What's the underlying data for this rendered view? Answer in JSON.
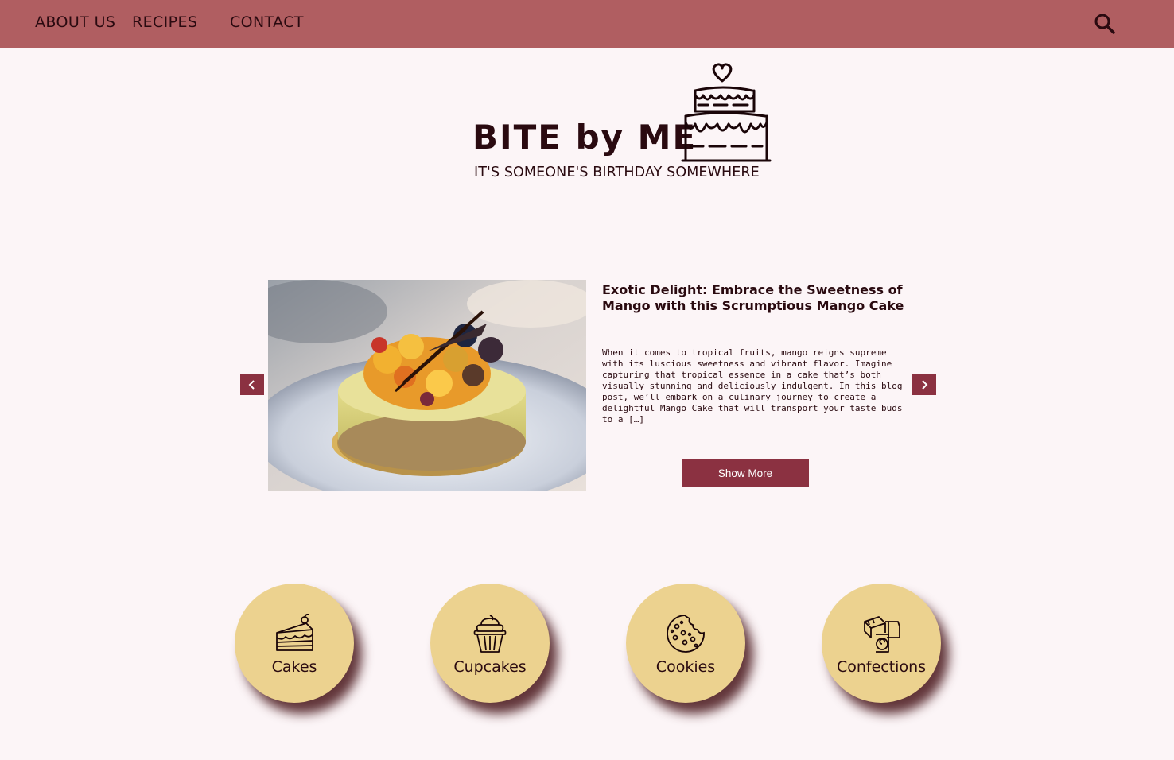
{
  "nav": {
    "items": [
      {
        "label": "ABOUT US"
      },
      {
        "label": "RECIPES"
      },
      {
        "label": "CONTACT"
      }
    ],
    "search_icon": "search-icon"
  },
  "brand": {
    "title": "BITE by ME",
    "tagline": "IT'S SOMEONE'S BIRTHDAY SOMEWHERE",
    "logo_icon": "layered-cake-icon"
  },
  "featured_post": {
    "title": "Exotic Delight: Embrace the Sweetness of Mango with this Scrumptious Mango Cake",
    "excerpt": "When it comes to tropical fruits, mango reigns supreme with its luscious sweetness and vibrant flavor. Imagine capturing that tropical essence in a cake that’s both visually stunning and deliciously indulgent. In this blog post, we’ll embark on a culinary journey to create a delightful Mango Cake that will transport your taste buds to a […]",
    "button_label": "Show More",
    "prev_icon": "chevron-left-icon",
    "next_icon": "chevron-right-icon"
  },
  "categories": [
    {
      "label": "Cakes",
      "icon": "cake-slice-icon"
    },
    {
      "label": "Cupcakes",
      "icon": "cupcake-icon"
    },
    {
      "label": "Cookies",
      "icon": "cookie-icon"
    },
    {
      "label": "Confections",
      "icon": "candy-box-icon"
    }
  ],
  "colors": {
    "nav_bar": "#b05e61",
    "page_background": "#fcf5f7",
    "accent": "#8b3141",
    "category_circle": "#ecd28f",
    "text_dark": "#2a0a10"
  }
}
